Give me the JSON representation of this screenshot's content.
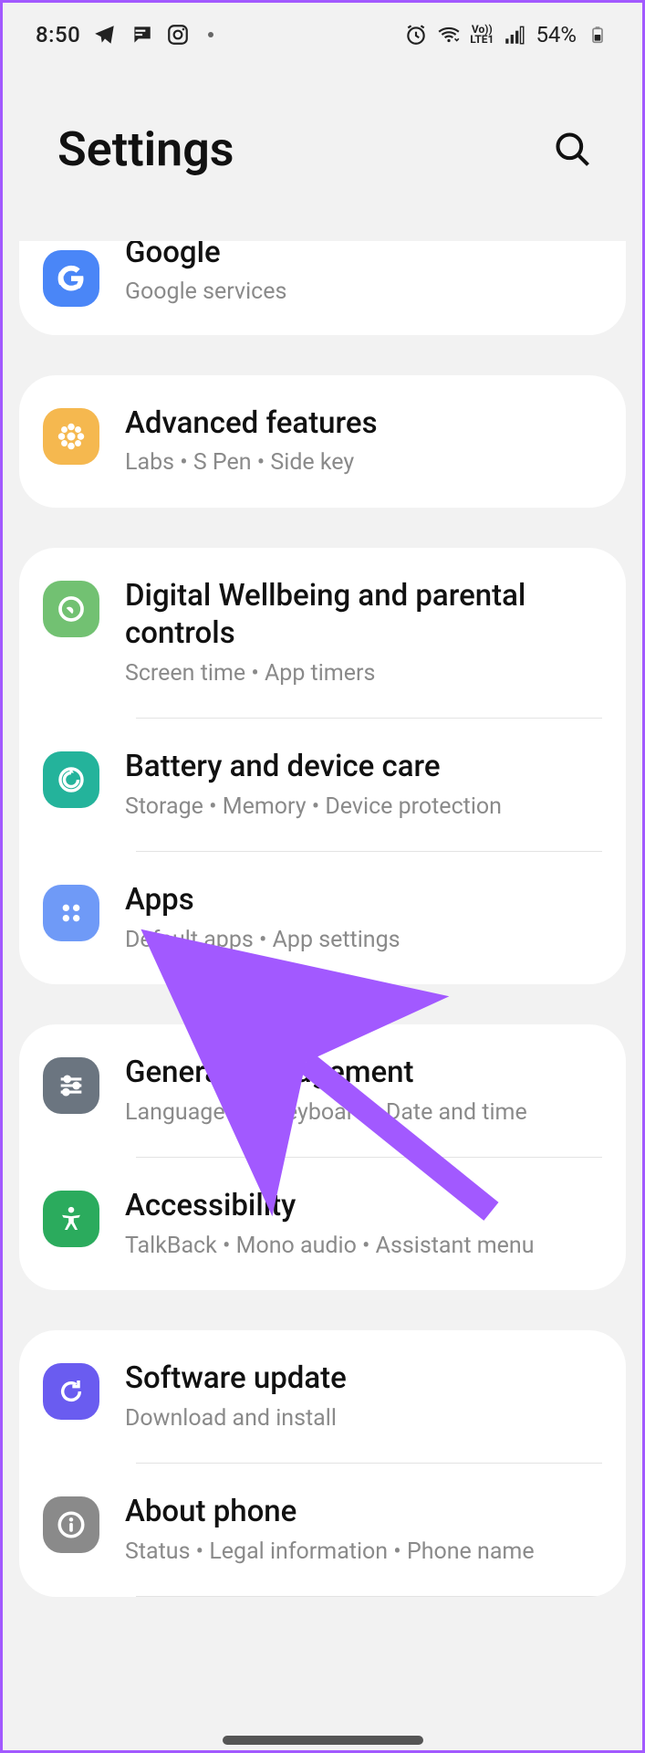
{
  "status": {
    "time": "8:50",
    "battery_percent": "54%",
    "network_label": "Vo))\nLTE1"
  },
  "header": {
    "title": "Settings"
  },
  "groups": [
    {
      "id": "google-group",
      "items": [
        {
          "icon": "google-icon",
          "bg": "bg-blue",
          "title": "Google",
          "subtitle": "Google services"
        }
      ]
    },
    {
      "id": "advanced-group",
      "items": [
        {
          "icon": "gear-flower-icon",
          "bg": "bg-orange",
          "title": "Advanced features",
          "subtitle": "Labs  •  S Pen  •  Side key"
        }
      ]
    },
    {
      "id": "care-group",
      "items": [
        {
          "icon": "wellbeing-icon",
          "bg": "bg-green",
          "title": "Digital Wellbeing and parental controls",
          "subtitle": "Screen time  •  App timers"
        },
        {
          "icon": "device-care-icon",
          "bg": "bg-teal",
          "title": "Battery and device care",
          "subtitle": "Storage  •  Memory  •  Device protection"
        },
        {
          "icon": "apps-icon",
          "bg": "bg-lightblue",
          "title": "Apps",
          "subtitle": "Default apps  •  App settings"
        }
      ]
    },
    {
      "id": "general-group",
      "items": [
        {
          "icon": "sliders-icon",
          "bg": "bg-slate",
          "title": "General management",
          "subtitle": "Language and keyboard  •  Date and time"
        },
        {
          "icon": "accessibility-icon",
          "bg": "bg-green2",
          "title": "Accessibility",
          "subtitle": "TalkBack  •  Mono audio  •  Assistant menu"
        }
      ]
    },
    {
      "id": "about-group",
      "items": [
        {
          "icon": "update-icon",
          "bg": "bg-indigo",
          "title": "Software update",
          "subtitle": "Download and install"
        },
        {
          "icon": "info-icon",
          "bg": "bg-gray",
          "title": "About phone",
          "subtitle": "Status  •  Legal information  •  Phone name"
        }
      ]
    }
  ]
}
